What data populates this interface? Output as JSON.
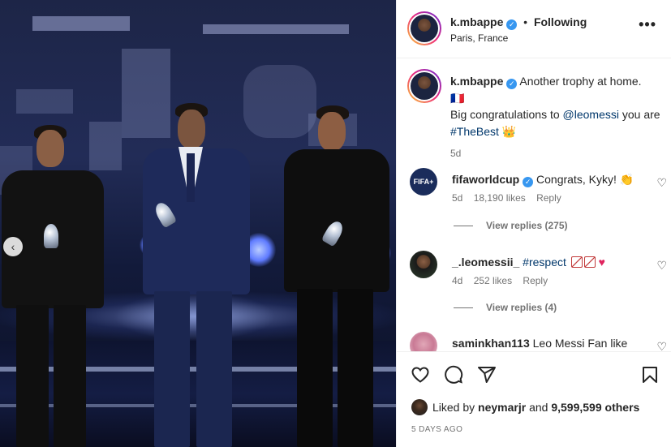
{
  "post": {
    "author": "k.mbappe",
    "follow_status": "Following",
    "location": "Paris, France",
    "more_glyph": "•••"
  },
  "caption": {
    "author": "k.mbappe",
    "line1": "Another trophy at home.",
    "line2": "🇫🇷",
    "line3_prefix": "Big congratulations to ",
    "mention": "@leomessi",
    "line3_suffix": " you are ",
    "hashtag": "#TheBest",
    "emoji": "👑",
    "age": "5d"
  },
  "comments": [
    {
      "author": "fifaworldcup",
      "avatar_text": "FIFA+",
      "text": "Congrats, Kyky! 👏",
      "age": "5d",
      "likes": "18,190 likes",
      "reply_label": "Reply",
      "view_replies": "View replies (275)"
    },
    {
      "author": "_.leomessii_",
      "hashtag": "#respect",
      "age": "4d",
      "likes": "252 likes",
      "reply_label": "Reply",
      "view_replies": "View replies (4)"
    },
    {
      "author": "saminkhan113",
      "text": "Leo Messi Fan like"
    }
  ],
  "likes": {
    "prefix": "Liked by ",
    "user": "neymarjr",
    "middle": " and ",
    "others": "9,599,599 others"
  },
  "timestamp": "5 DAYS AGO",
  "icons": [
    "verified-badge",
    "more-icon",
    "heart-icon",
    "comment-icon",
    "share-icon",
    "bookmark-icon",
    "chevron-left-icon"
  ],
  "colors": {
    "verified": "#3797f0",
    "link": "#00376b",
    "meta": "#737373"
  }
}
